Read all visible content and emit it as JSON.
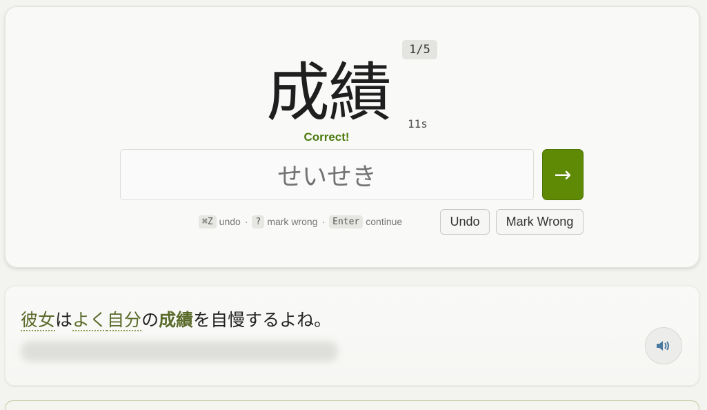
{
  "card": {
    "counter": "1/5",
    "kanji": "成績",
    "timer": "11s",
    "feedback": "Correct!",
    "answer_value": "せいせき",
    "next_icon": "arrow-right-icon",
    "accent_color": "#5f8a06"
  },
  "hints": {
    "undo_key": "⌘Z",
    "undo_label": "undo",
    "separator": "·",
    "wrong_key": "?",
    "wrong_label": "mark wrong",
    "continue_key": "Enter",
    "continue_label": "continue"
  },
  "buttons": {
    "undo": "Undo",
    "mark_wrong": "Mark Wrong"
  },
  "example": {
    "words": [
      {
        "text": "彼女",
        "type": "vocab"
      },
      {
        "text": "は",
        "type": "plain"
      },
      {
        "text": "よく",
        "type": "vocab"
      },
      {
        "text": "自分",
        "type": "vocab"
      },
      {
        "text": "の",
        "type": "plain"
      },
      {
        "text": "成績",
        "type": "target"
      },
      {
        "text": "を自慢するよね。",
        "type": "plain"
      }
    ],
    "audio_icon": "speaker-icon"
  }
}
